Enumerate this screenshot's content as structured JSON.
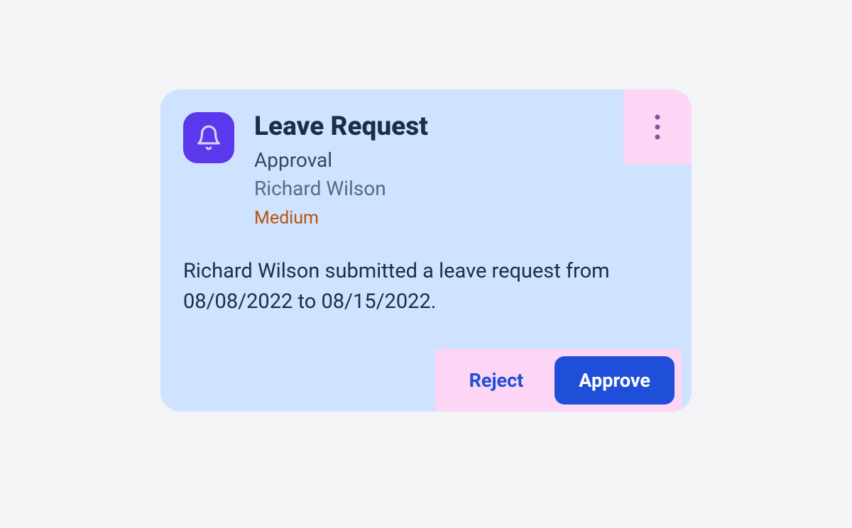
{
  "card": {
    "title": "Leave Request",
    "subtitle": "Approval",
    "author": "Richard Wilson",
    "priority": "Medium",
    "body": "Richard Wilson submitted a leave request from 08/08/2022 to 08/15/2022.",
    "actions": {
      "reject": "Reject",
      "approve": "Approve"
    }
  }
}
